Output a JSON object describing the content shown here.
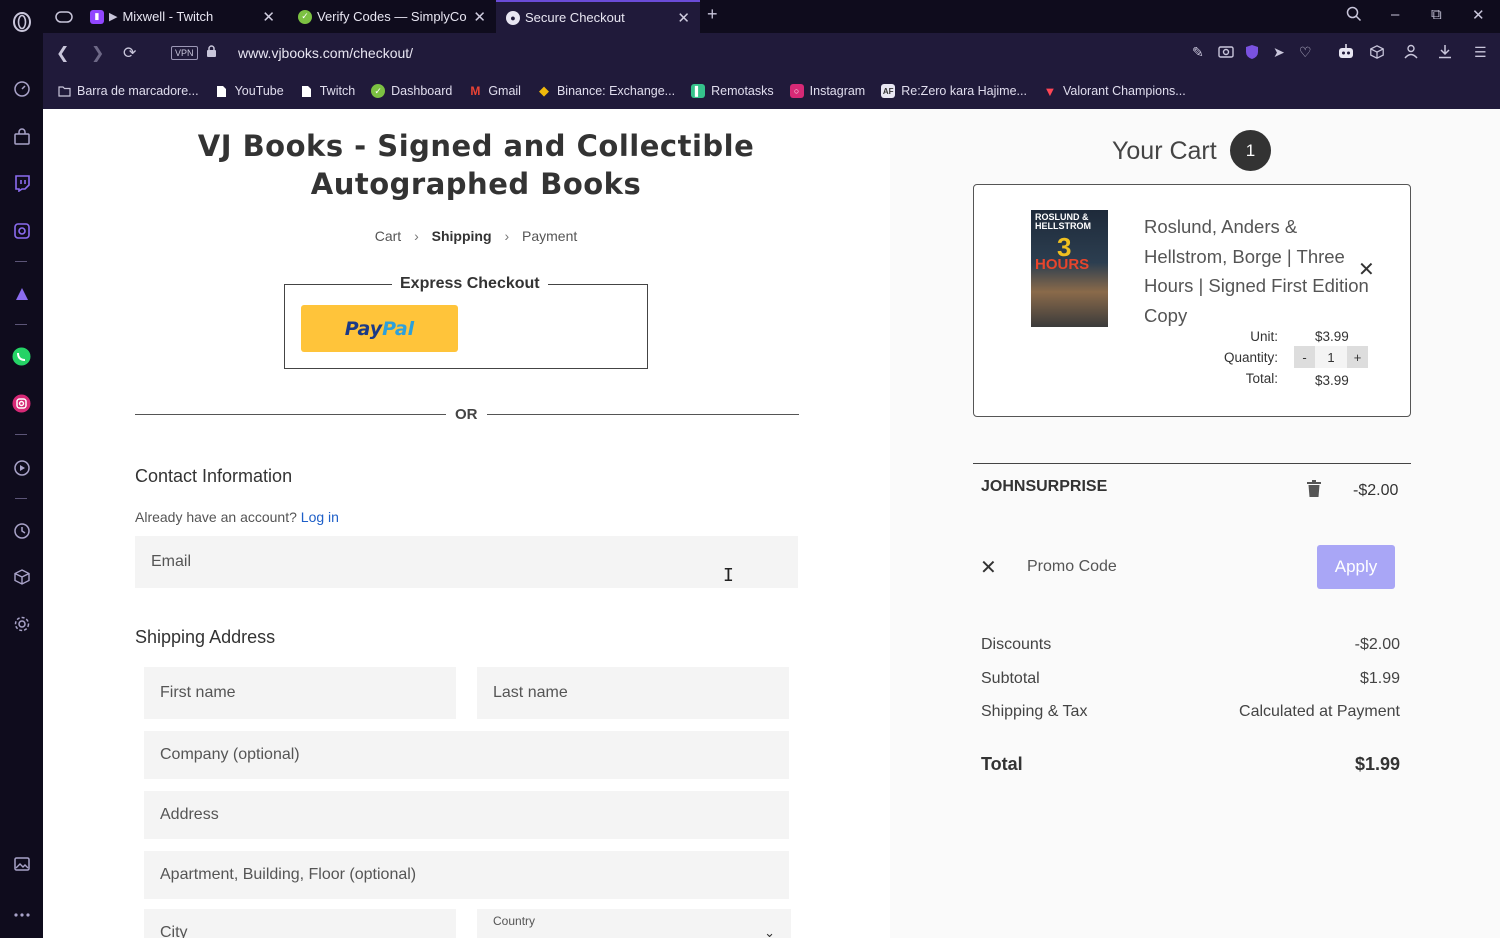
{
  "browser": {
    "tabs": [
      {
        "title": "Mixwell - Twitch",
        "active": false
      },
      {
        "title": "Verify Codes — SimplyCodes",
        "active": false
      },
      {
        "title": "Secure Checkout",
        "active": true
      }
    ],
    "new_tab": "+",
    "url": "www.vjbooks.com/checkout/",
    "vpn_label": "VPN",
    "bookmarks": [
      {
        "label": "Barra de marcadore...",
        "icon": "folder-icon",
        "color": "#bbbbbb"
      },
      {
        "label": "YouTube",
        "icon": "document-icon",
        "color": "#ffffff"
      },
      {
        "label": "Twitch",
        "icon": "document-icon",
        "color": "#ffffff"
      },
      {
        "label": "Dashboard",
        "icon": "dashboard-icon",
        "color": "#7cc142"
      },
      {
        "label": "Gmail",
        "icon": "gmail-icon",
        "color": "#ea4335"
      },
      {
        "label": "Binance: Exchange...",
        "icon": "binance-icon",
        "color": "#f0b90b"
      },
      {
        "label": "Remotasks",
        "icon": "remotasks-icon",
        "color": "#35c28b"
      },
      {
        "label": "Instagram",
        "icon": "instagram-icon",
        "color": "#d62976"
      },
      {
        "label": "Re:Zero kara Hajime...",
        "icon": "animeflv-icon",
        "color": "#333333"
      },
      {
        "label": "Valorant Champions...",
        "icon": "valorant-icon",
        "color": "#ff4655"
      }
    ]
  },
  "checkout": {
    "site_title_line1": "VJ Books - Signed and Collectible",
    "site_title_line2": "Autographed Books",
    "breadcrumb": {
      "cart": "Cart",
      "shipping": "Shipping",
      "payment": "Payment"
    },
    "express_checkout": "Express Checkout",
    "paypal": {
      "pay": "Pay",
      "pal": "Pal"
    },
    "or": "OR",
    "contact": {
      "heading": "Contact Information",
      "have_account": "Already have an account?",
      "login": "Log in",
      "email_placeholder": "Email"
    },
    "shipping": {
      "heading": "Shipping Address",
      "first_name": "First name",
      "last_name": "Last name",
      "company": "Company (optional)",
      "address": "Address",
      "apartment": "Apartment, Building, Floor (optional)",
      "city": "City",
      "country_label": "Country"
    }
  },
  "cart": {
    "title": "Your Cart",
    "count": "1",
    "item": {
      "cover_author": "ROSLUND & HELLSTROM",
      "cover_number": "3",
      "cover_word": "HOURS",
      "name": "Roslund, Anders & Hellstrom, Borge | Three Hours | Signed First Edition Copy",
      "unit_label": "Unit:",
      "unit_price": "$3.99",
      "quantity_label": "Quantity:",
      "quantity": "1",
      "minus": "-",
      "plus": "+",
      "total_label": "Total:",
      "total": "$3.99"
    },
    "promo": {
      "code": "JOHNSURPRISE",
      "amount": "-$2.00",
      "placeholder": "Promo Code",
      "apply": "Apply"
    },
    "summary": {
      "discounts_label": "Discounts",
      "discounts": "-$2.00",
      "subtotal_label": "Subtotal",
      "subtotal": "$1.99",
      "shipping_label": "Shipping & Tax",
      "shipping": "Calculated at Payment",
      "total_label": "Total",
      "total": "$1.99"
    },
    "colors": {
      "apply_button": "#a9a6f6",
      "paypal_button": "#ffc43a",
      "accent_link": "#1e5fc8"
    }
  }
}
